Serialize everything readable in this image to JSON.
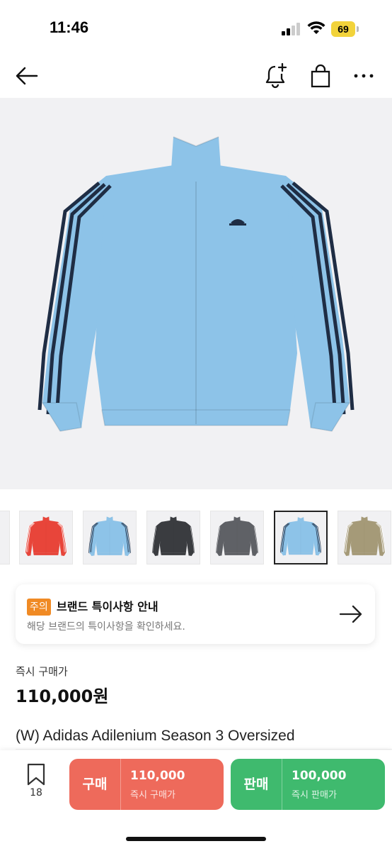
{
  "status_bar": {
    "time": "11:46",
    "battery": "69"
  },
  "nav": {
    "icons": [
      "back-arrow-icon",
      "alert-plus-icon",
      "shopping-bag-icon",
      "more-icon"
    ]
  },
  "hero": {
    "jacket_color": "#8dc3e8",
    "stripe_color": "#1f2d44"
  },
  "thumbnails": [
    {
      "color": "#e8453a",
      "stripe": "#ffffff"
    },
    {
      "color": "#8dc3e8",
      "stripe": "#1f2d44"
    },
    {
      "color": "#3a3c40",
      "stripe": "#3a3c40"
    },
    {
      "color": "#5f6166",
      "stripe": "#5f6166"
    },
    {
      "color": "#8dc3e8",
      "stripe": "#1f2d44",
      "selected": true
    },
    {
      "color": "#a59a78",
      "stripe": "#ffffff"
    }
  ],
  "notice": {
    "badge": "주의",
    "title": "브랜드 특이사항 안내",
    "subtitle": "해당 브랜드의 특이사항을 확인하세요."
  },
  "price": {
    "label": "즉시 구매가",
    "value": "110,000원"
  },
  "product": {
    "name": "(W) Adidas Adilenium Season 3 Oversized"
  },
  "bottom_bar": {
    "wish_count": "18",
    "buy": {
      "label": "구매",
      "price": "110,000",
      "sub": "즉시 구매가",
      "color": "#ee6a5b"
    },
    "sell": {
      "label": "판매",
      "price": "100,000",
      "sub": "즉시 판매가",
      "color": "#3fba6e"
    }
  }
}
